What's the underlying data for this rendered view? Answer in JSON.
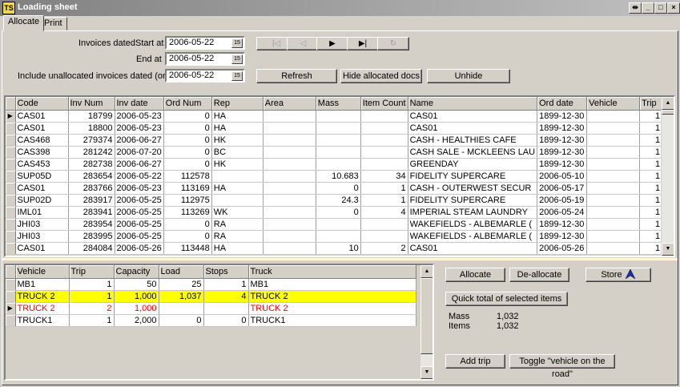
{
  "window": {
    "title": "Loading sheet",
    "icon_text": "TS",
    "controls": [
      "pin",
      "minimize",
      "maximize",
      "close"
    ]
  },
  "tabs": [
    {
      "label": "Allocate",
      "active": true
    },
    {
      "label": "Print",
      "active": false
    }
  ],
  "filters": {
    "invoices_dated_label": "Invoices dated",
    "start_label": "Start at",
    "start_value": "2006-05-22",
    "end_label": "End at",
    "end_value": "2006-05-22",
    "unallocated_label": "Include unallocated invoices dated (or later)",
    "unallocated_value": "2006-05-22"
  },
  "nav_buttons": {
    "first": "|◁",
    "prev": "◁",
    "next": "▶",
    "last": "▶|",
    "refresh": "↻"
  },
  "actions": {
    "refresh": "Refresh",
    "hide_allocated": "Hide allocated docs",
    "unhide": "Unhide"
  },
  "invoices": {
    "columns": [
      "Code",
      "Inv Num",
      "Inv date",
      "Ord Num",
      "Rep",
      "Area",
      "Mass",
      "Item Count",
      "Name",
      "Ord date",
      "Vehicle",
      "Trip"
    ],
    "rows": [
      {
        "current": true,
        "code": "CAS01",
        "inv_num": "18799",
        "inv_date": "2006-05-23",
        "ord_num": "0",
        "rep": "HA",
        "area": "",
        "mass": "",
        "item_count": "",
        "name": "CAS01",
        "ord_date": "1899-12-30",
        "vehicle": "",
        "trip": "1"
      },
      {
        "current": false,
        "code": "CAS01",
        "inv_num": "18800",
        "inv_date": "2006-05-23",
        "ord_num": "0",
        "rep": "HA",
        "area": "",
        "mass": "",
        "item_count": "",
        "name": "CAS01",
        "ord_date": "1899-12-30",
        "vehicle": "",
        "trip": "1"
      },
      {
        "current": false,
        "code": "CAS468",
        "inv_num": "279374",
        "inv_date": "2006-06-27",
        "ord_num": "0",
        "rep": "HK",
        "area": "",
        "mass": "",
        "item_count": "",
        "name": "CASH - HEALTHIES CAFE",
        "ord_date": "1899-12-30",
        "vehicle": "",
        "trip": "1"
      },
      {
        "current": false,
        "code": "CAS398",
        "inv_num": "281242",
        "inv_date": "2006-07-20",
        "ord_num": "0",
        "rep": "BC",
        "area": "",
        "mass": "",
        "item_count": "",
        "name": "CASH SALE - MCKLEENS LAU",
        "ord_date": "1899-12-30",
        "vehicle": "",
        "trip": "1"
      },
      {
        "current": false,
        "code": "CAS453",
        "inv_num": "282738",
        "inv_date": "2006-06-27",
        "ord_num": "0",
        "rep": "HK",
        "area": "",
        "mass": "",
        "item_count": "",
        "name": "GREENDAY",
        "ord_date": "1899-12-30",
        "vehicle": "",
        "trip": "1"
      },
      {
        "current": false,
        "code": "SUP05D",
        "inv_num": "283654",
        "inv_date": "2006-05-22",
        "ord_num": "112578",
        "rep": "",
        "area": "",
        "mass": "10.683",
        "item_count": "34",
        "name": "FIDELITY SUPERCARE",
        "ord_date": "2006-05-10",
        "vehicle": "",
        "trip": "1"
      },
      {
        "current": false,
        "code": "CAS01",
        "inv_num": "283766",
        "inv_date": "2006-05-23",
        "ord_num": "113169",
        "rep": "HA",
        "area": "",
        "mass": "0",
        "item_count": "1",
        "name": "CASH - OUTERWEST SECUR",
        "ord_date": "2006-05-17",
        "vehicle": "",
        "trip": "1"
      },
      {
        "current": false,
        "code": "SUP02D",
        "inv_num": "283917",
        "inv_date": "2006-05-25",
        "ord_num": "112975",
        "rep": "",
        "area": "",
        "mass": "24.3",
        "item_count": "1",
        "name": "FIDELITY SUPERCARE",
        "ord_date": "2006-05-19",
        "vehicle": "",
        "trip": "1"
      },
      {
        "current": false,
        "code": "IML01",
        "inv_num": "283941",
        "inv_date": "2006-05-25",
        "ord_num": "113269",
        "rep": "WK",
        "area": "",
        "mass": "0",
        "item_count": "4",
        "name": "IMPERIAL STEAM LAUNDRY",
        "ord_date": "2006-05-24",
        "vehicle": "",
        "trip": "1"
      },
      {
        "current": false,
        "code": "JHI03",
        "inv_num": "283954",
        "inv_date": "2006-05-25",
        "ord_num": "0",
        "rep": "RA",
        "area": "",
        "mass": "",
        "item_count": "",
        "name": "WAKEFIELDS - ALBEMARLE (",
        "ord_date": "1899-12-30",
        "vehicle": "",
        "trip": "1"
      },
      {
        "current": false,
        "code": "JHI03",
        "inv_num": "283995",
        "inv_date": "2006-05-25",
        "ord_num": "0",
        "rep": "RA",
        "area": "",
        "mass": "",
        "item_count": "",
        "name": "WAKEFIELDS - ALBEMARLE (",
        "ord_date": "1899-12-30",
        "vehicle": "",
        "trip": "1"
      },
      {
        "current": false,
        "code": "CAS01",
        "inv_num": "284084",
        "inv_date": "2006-05-26",
        "ord_num": "113448",
        "rep": "HA",
        "area": "",
        "mass": "10",
        "item_count": "2",
        "name": "CAS01",
        "ord_date": "2006-05-26",
        "vehicle": "",
        "trip": "1"
      }
    ]
  },
  "vehicles": {
    "columns": [
      "Vehicle",
      "Trip",
      "Capacity",
      "Load",
      "Stops",
      "Truck"
    ],
    "rows": [
      {
        "current": false,
        "style": "normal",
        "vehicle": "MB1",
        "trip": "1",
        "capacity": "50",
        "load": "25",
        "stops": "1",
        "truck": "MB1"
      },
      {
        "current": false,
        "style": "yellow",
        "vehicle": "TRUCK 2",
        "trip": "1",
        "capacity": "1,000",
        "load": "1,037",
        "stops": "4",
        "truck": "TRUCK 2"
      },
      {
        "current": true,
        "style": "red",
        "vehicle": "TRUCK 2",
        "trip": "2",
        "capacity": "1,000",
        "load": "",
        "stops": "",
        "truck": "TRUCK 2"
      },
      {
        "current": false,
        "style": "normal",
        "vehicle": "TRUCK1",
        "trip": "1",
        "capacity": "2,000",
        "load": "0",
        "stops": "0",
        "truck": "TRUCK1"
      }
    ]
  },
  "side_panel": {
    "allocate": "Allocate",
    "deallocate": "De-allocate",
    "store": "Store",
    "quick_total": "Quick total of selected items",
    "mass_label": "Mass",
    "mass_value": "1,032",
    "items_label": "Items",
    "items_value": "1,032",
    "add_trip": "Add trip",
    "toggle_vehicle": "Toggle \"vehicle on the road\""
  }
}
